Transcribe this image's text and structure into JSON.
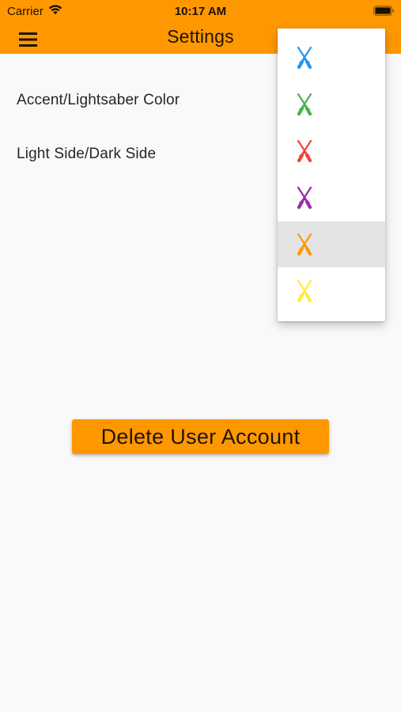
{
  "status_bar": {
    "carrier": "Carrier",
    "time": "10:17 AM",
    "wifi_icon": "wifi-icon",
    "battery_icon": "battery-full-icon"
  },
  "app_bar": {
    "title": "Settings",
    "menu_icon": "hamburger-menu-icon",
    "background_color": "#ff9800"
  },
  "settings": {
    "rows": [
      {
        "label": "Accent/Lightsaber Color"
      },
      {
        "label": "Light Side/Dark Side"
      }
    ]
  },
  "color_dropdown": {
    "options": [
      {
        "icon": "crossed-lightsabers-icon",
        "color": "#2196f3",
        "selected": false
      },
      {
        "icon": "crossed-lightsabers-icon",
        "color": "#4caf50",
        "selected": false
      },
      {
        "icon": "crossed-lightsabers-icon",
        "color": "#f44336",
        "selected": false
      },
      {
        "icon": "crossed-lightsabers-icon",
        "color": "#9c27b0",
        "selected": false
      },
      {
        "icon": "crossed-lightsabers-icon",
        "color": "#ff9800",
        "selected": true
      },
      {
        "icon": "crossed-lightsabers-icon",
        "color": "#ffeb3b",
        "selected": false
      }
    ]
  },
  "actions": {
    "delete_account_label": "Delete User Account",
    "button_color": "#ff9800"
  }
}
